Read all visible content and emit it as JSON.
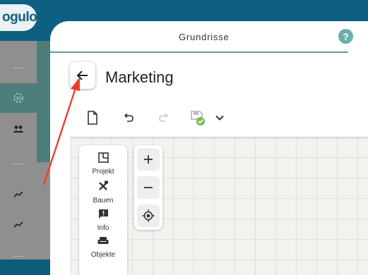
{
  "app": {
    "logo_text": "ogulo"
  },
  "dialog": {
    "title": "Grundrisse",
    "help_label": "?",
    "page_title": "Marketing"
  },
  "toolbar": {
    "new_icon": "file-icon",
    "undo_icon": "undo-icon",
    "redo_icon": "redo-icon",
    "save_icon": "save-check-icon",
    "more_icon": "chevron-down-icon"
  },
  "tools": [
    {
      "label": "Projekt",
      "icon": "floorplan-icon"
    },
    {
      "label": "Bauen",
      "icon": "tools-icon"
    },
    {
      "label": "Info",
      "icon": "info-comment-icon"
    },
    {
      "label": "Objekte",
      "icon": "armchair-icon"
    }
  ],
  "zoom": {
    "in": "+",
    "out": "−"
  },
  "sidebar": [
    {
      "icon": "view-3d-icon",
      "active": true
    },
    {
      "icon": "users-icon",
      "active": false
    },
    {
      "icon": "trend-icon",
      "active": false
    },
    {
      "icon": "trend-icon",
      "active": false
    }
  ],
  "colors": {
    "header": "#0e5f80",
    "accent": "#5a9fa5",
    "sidebar_active": "#4c7e7b",
    "annotation_arrow": "#e8402a"
  }
}
